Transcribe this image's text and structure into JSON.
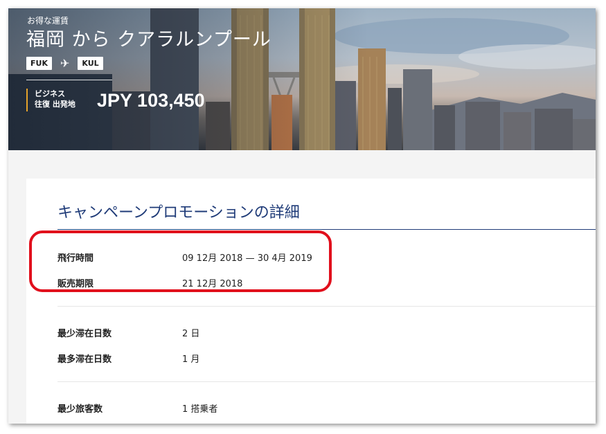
{
  "hero": {
    "label": "お得な運賃",
    "title": "福岡 から クアラルンプール",
    "origin_code": "FUK",
    "destination_code": "KUL",
    "plane_icon": "airplane-icon",
    "fare_class": "ビジネス",
    "fare_type": "往復 出発地",
    "price": "JPY 103,450"
  },
  "details": {
    "title": "キャンペーンプロモーションの詳細",
    "rows": [
      {
        "label": "飛行時間",
        "value": "09 12月 2018 — 30 4月 2019"
      },
      {
        "label": "販売期限",
        "value": "21 12月 2018"
      },
      {
        "label": "最少滞在日数",
        "value": "2 日"
      },
      {
        "label": "最多滞在日数",
        "value": "1 月"
      },
      {
        "label": "最少旅客数",
        "value": "1 搭乗者"
      }
    ]
  },
  "colors": {
    "title": "#1f3b78",
    "highlight": "#e10f1c",
    "fare_accent": "#e5a32a"
  }
}
